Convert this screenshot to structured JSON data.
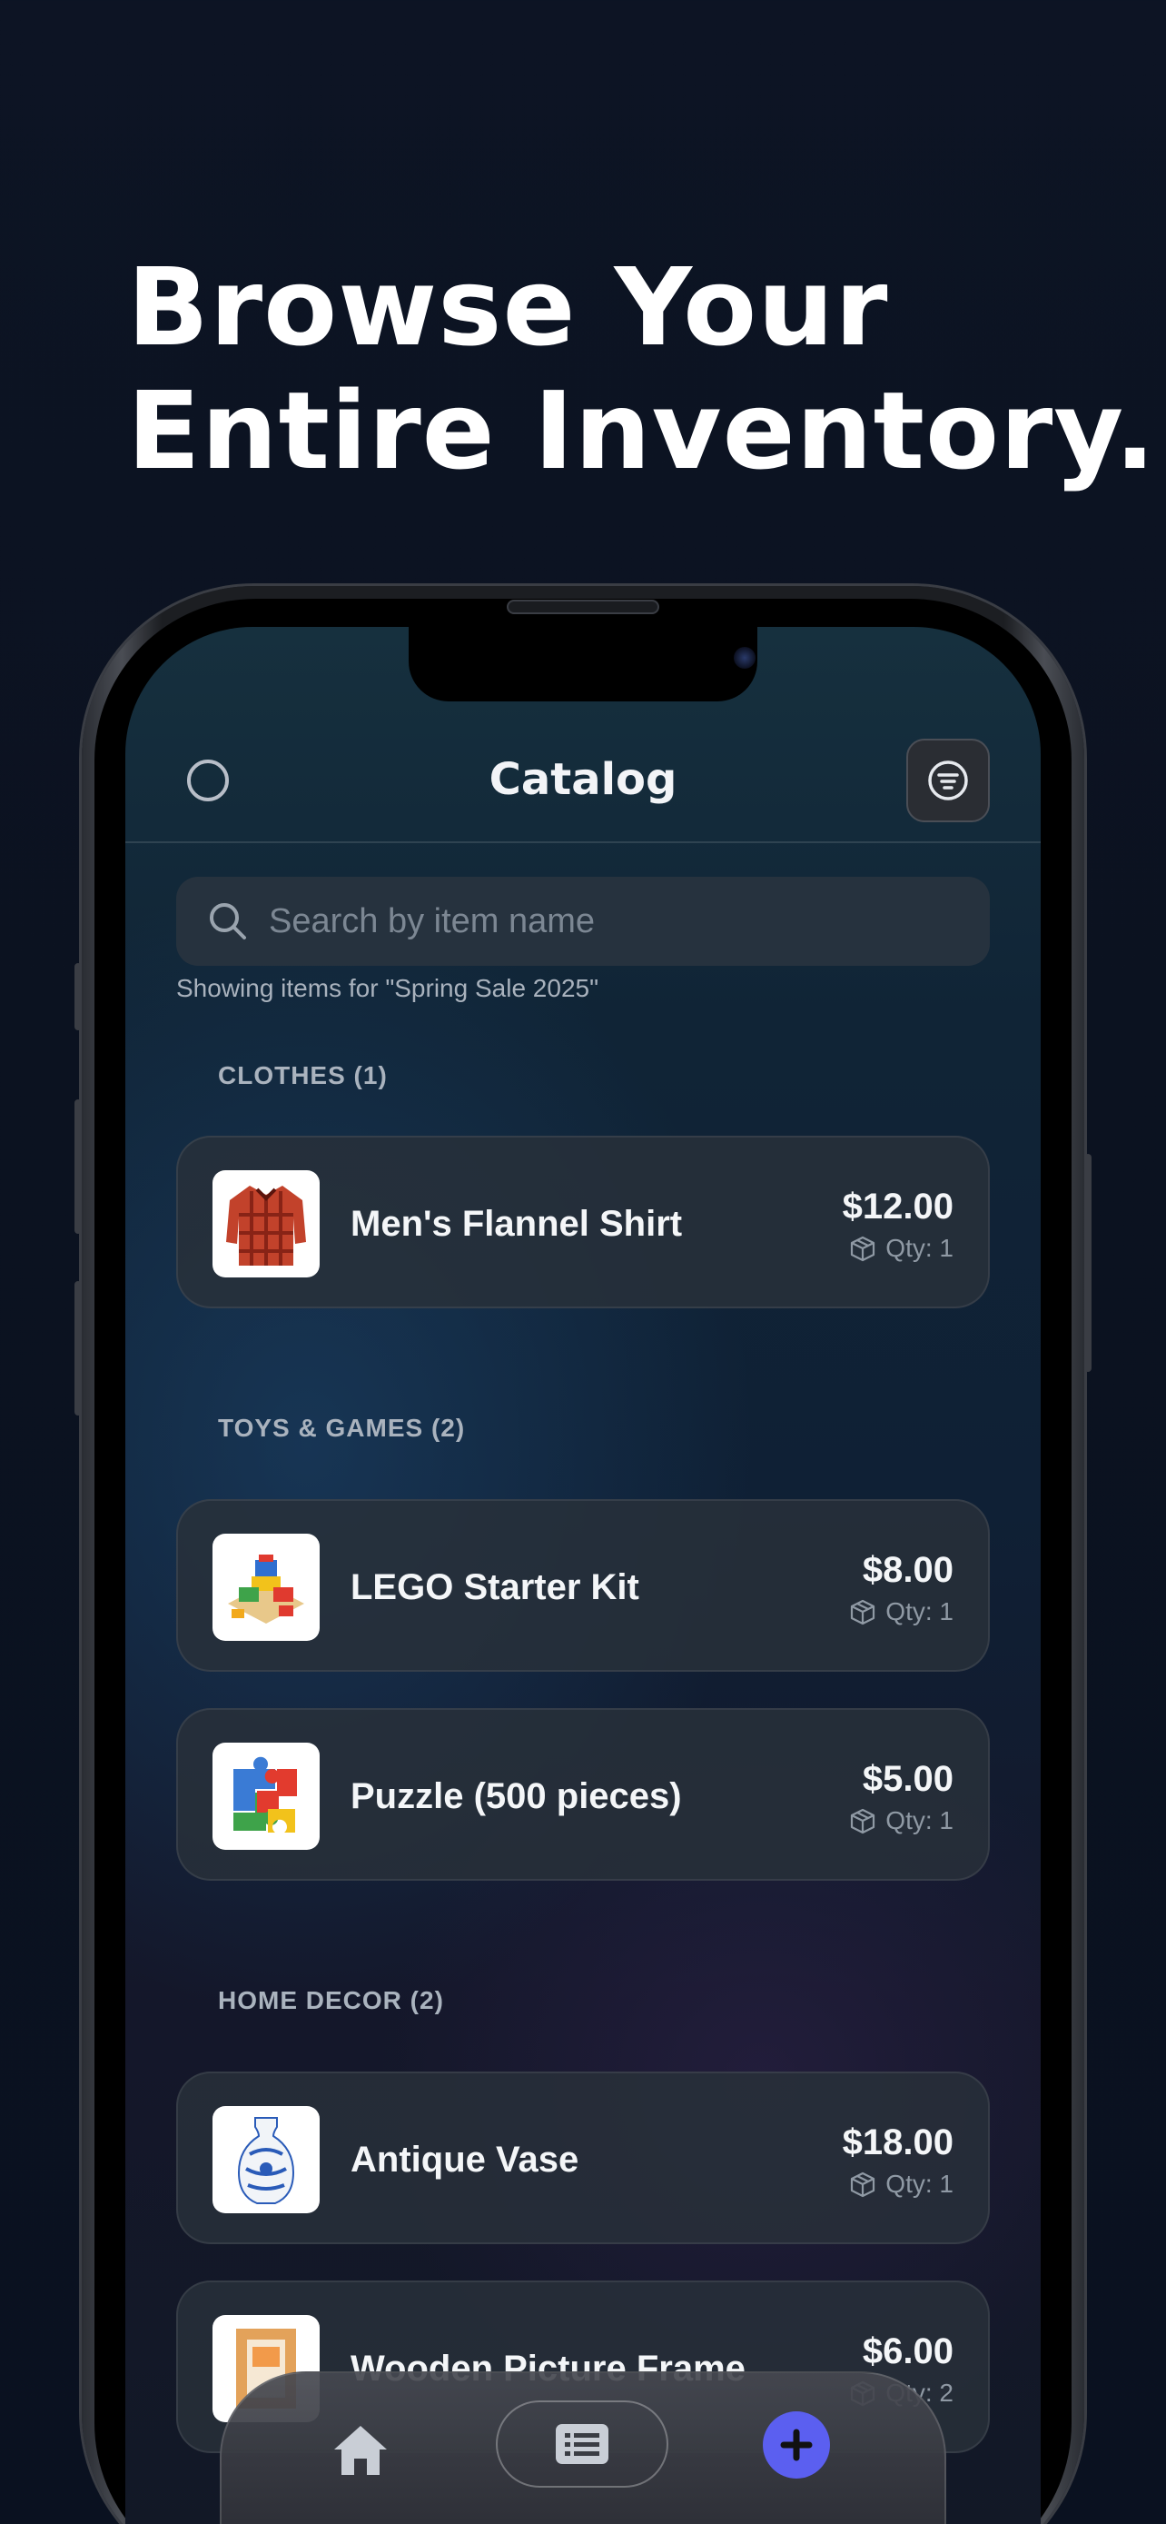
{
  "headline": {
    "line1": "Browse Your",
    "line2": "Entire Inventory."
  },
  "navbar": {
    "title": "Catalog",
    "filter_icon": "filter-icon",
    "left_icon": "circle-icon"
  },
  "search": {
    "placeholder": "Search by item name",
    "icon": "search-icon"
  },
  "showing_text": "Showing items for \"Spring Sale 2025\"",
  "sections": [
    {
      "label": "CLOTHES (1)"
    },
    {
      "label": "TOYS & GAMES (2)"
    },
    {
      "label": "HOME DECOR (2)"
    }
  ],
  "items": [
    {
      "name": "Men's Flannel Shirt",
      "price": "$12.00",
      "qty": "Qty: 1",
      "icon": "flannel-shirt-image"
    },
    {
      "name": "LEGO Starter Kit",
      "price": "$8.00",
      "qty": "Qty: 1",
      "icon": "lego-image"
    },
    {
      "name": "Puzzle (500 pieces)",
      "price": "$5.00",
      "qty": "Qty: 1",
      "icon": "puzzle-image"
    },
    {
      "name": "Antique Vase",
      "price": "$18.00",
      "qty": "Qty: 1",
      "icon": "vase-image"
    },
    {
      "name": "Wooden Picture Frame",
      "price": "$6.00",
      "qty": "Qty: 2",
      "icon": "picture-frame-image"
    }
  ],
  "tabbar": {
    "home_icon": "home-icon",
    "list_icon": "list-icon",
    "add_icon": "plus-icon"
  },
  "colors": {
    "accent": "#5b5ff0",
    "background": "#0b1220"
  }
}
